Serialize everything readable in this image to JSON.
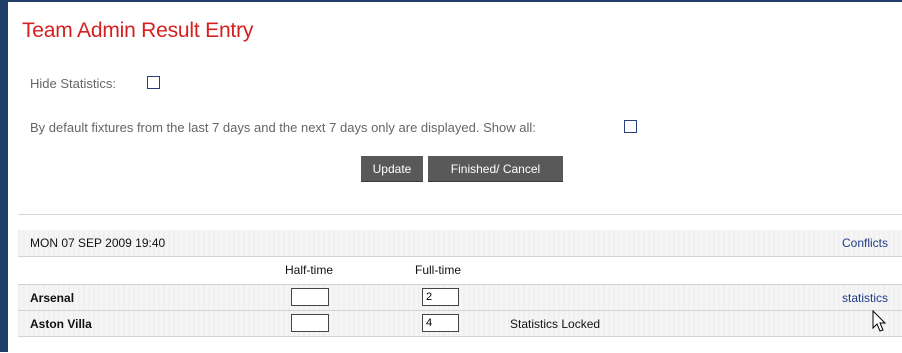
{
  "page": {
    "title": "Team Admin Result Entry",
    "hide_statistics_label": "Hide Statistics:",
    "fixtures_note": "By default fixtures from the last 7 days and the next 7 days only are displayed. Show all:"
  },
  "buttons": {
    "update": "Update",
    "finished_cancel": "Finished/ Cancel"
  },
  "fixture": {
    "datetime": "MON 07 SEP 2009 19:40",
    "conflicts_link": "Conflicts",
    "col_halftime": "Half-time",
    "col_fulltime": "Full-time",
    "teams": [
      {
        "name": "Arsenal",
        "half_time": "",
        "full_time": "2",
        "action": "statistics"
      },
      {
        "name": "Aston Villa",
        "half_time": "",
        "full_time": "4",
        "status": "Statistics Locked"
      }
    ]
  },
  "icons": [
    "checkbox-icon",
    "mouse-pointer-icon"
  ],
  "colors": {
    "title": "#d42020",
    "button": "#595959",
    "link": "#1f3c88",
    "frame": "#1f3f6a"
  }
}
